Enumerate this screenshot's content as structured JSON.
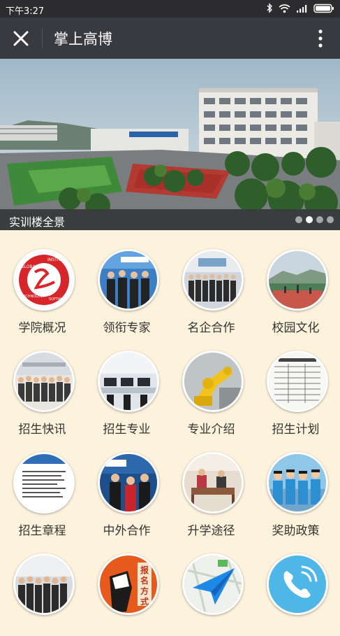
{
  "status": {
    "time": "下午3:27"
  },
  "nav": {
    "title": "掌上高博"
  },
  "banner": {
    "caption": "实训楼全景",
    "slide_count": 4,
    "active_slide": 2
  },
  "logo_text": [
    "GLOBAL",
    "INSTITUTE",
    "TECHNOLOGY",
    "SOFTWARE"
  ],
  "poster_text": [
    "报",
    "名",
    "方",
    "式"
  ],
  "grid": [
    {
      "label": "学院概况",
      "icon": "college-logo-icon"
    },
    {
      "label": "领衔专家",
      "icon": "experts-photo-icon"
    },
    {
      "label": "名企合作",
      "icon": "enterprise-photo-icon"
    },
    {
      "label": "校园文化",
      "icon": "campus-photo-icon"
    },
    {
      "label": "招生快讯",
      "icon": "news-photo-icon"
    },
    {
      "label": "招生专业",
      "icon": "majors-photo-icon"
    },
    {
      "label": "专业介绍",
      "icon": "robot-arm-icon"
    },
    {
      "label": "招生计划",
      "icon": "plan-document-icon"
    },
    {
      "label": "招生章程",
      "icon": "charter-document-icon"
    },
    {
      "label": "中外合作",
      "icon": "cooperation-photo-icon"
    },
    {
      "label": "升学途径",
      "icon": "classroom-photo-icon"
    },
    {
      "label": "奖助政策",
      "icon": "students-photo-icon"
    },
    {
      "label": "",
      "icon": "group-photo-icon"
    },
    {
      "label": "",
      "icon": "fist-poster-icon"
    },
    {
      "label": "",
      "icon": "paper-plane-map-icon"
    },
    {
      "label": "",
      "icon": "phone-icon"
    }
  ],
  "colors": {
    "status_bar": "#2c2c2e",
    "nav_bar": "#393a3f",
    "background": "#fdf3dd"
  }
}
